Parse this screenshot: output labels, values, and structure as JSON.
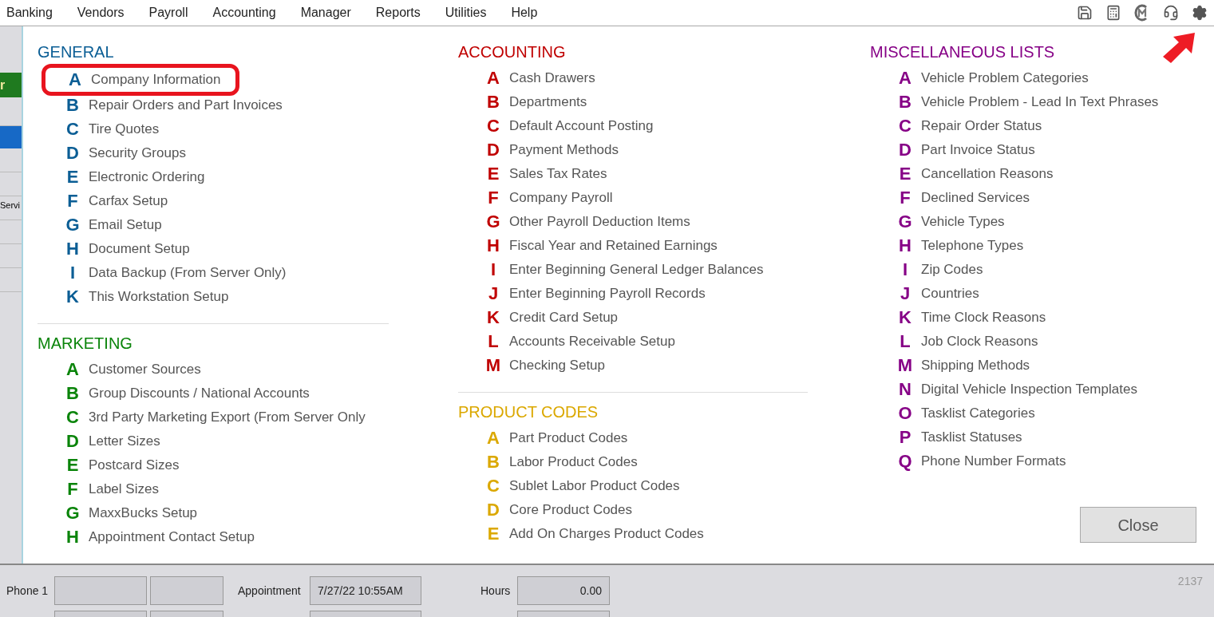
{
  "menu": [
    "Banking",
    "Vendors",
    "Payroll",
    "Accounting",
    "Manager",
    "Reports",
    "Utilities",
    "Help"
  ],
  "left_strip": {
    "button": "r",
    "text": "Servi"
  },
  "columns": [
    [
      {
        "title": "GENERAL",
        "color": "#0b5e95",
        "items": [
          {
            "letter": "A",
            "label": "Company Information",
            "circled": true
          },
          {
            "letter": "B",
            "label": "Repair Orders and Part Invoices",
            "circled": false
          },
          {
            "letter": "C",
            "label": "Tire Quotes",
            "circled": false
          },
          {
            "letter": "D",
            "label": "Security Groups",
            "circled": false
          },
          {
            "letter": "E",
            "label": "Electronic Ordering",
            "circled": false
          },
          {
            "letter": "F",
            "label": "Carfax Setup",
            "circled": false
          },
          {
            "letter": "G",
            "label": "Email Setup",
            "circled": false
          },
          {
            "letter": "H",
            "label": "Document Setup",
            "circled": false
          },
          {
            "letter": "I",
            "label": "Data Backup (From Server Only)",
            "circled": false
          },
          {
            "letter": "K",
            "label": "This Workstation Setup",
            "circled": false
          }
        ]
      },
      {
        "title": "MARKETING",
        "color": "#0a840a",
        "items": [
          {
            "letter": "A",
            "label": "Customer Sources",
            "circled": false
          },
          {
            "letter": "B",
            "label": "Group Discounts / National Accounts",
            "circled": false
          },
          {
            "letter": "C",
            "label": "3rd Party Marketing Export (From Server Only",
            "circled": false
          },
          {
            "letter": "D",
            "label": "Letter Sizes",
            "circled": false
          },
          {
            "letter": "E",
            "label": "Postcard Sizes",
            "circled": false
          },
          {
            "letter": "F",
            "label": "Label Sizes",
            "circled": false
          },
          {
            "letter": "G",
            "label": "MaxxBucks Setup",
            "circled": false
          },
          {
            "letter": "H",
            "label": "Appointment Contact Setup",
            "circled": false
          }
        ]
      }
    ],
    [
      {
        "title": "ACCOUNTING",
        "color": "#c00000",
        "items": [
          {
            "letter": "A",
            "label": "Cash Drawers",
            "circled": false
          },
          {
            "letter": "B",
            "label": "Departments",
            "circled": false
          },
          {
            "letter": "C",
            "label": "Default Account Posting",
            "circled": false
          },
          {
            "letter": "D",
            "label": "Payment Methods",
            "circled": false
          },
          {
            "letter": "E",
            "label": "Sales Tax Rates",
            "circled": false
          },
          {
            "letter": "F",
            "label": "Company Payroll",
            "circled": false
          },
          {
            "letter": "G",
            "label": "Other Payroll Deduction Items",
            "circled": false
          },
          {
            "letter": "H",
            "label": "Fiscal Year and Retained Earnings",
            "circled": false
          },
          {
            "letter": "I",
            "label": "Enter Beginning General Ledger Balances",
            "circled": false
          },
          {
            "letter": "J",
            "label": "Enter Beginning Payroll Records",
            "circled": false
          },
          {
            "letter": "K",
            "label": "Credit Card Setup",
            "circled": false
          },
          {
            "letter": "L",
            "label": "Accounts Receivable Setup",
            "circled": false
          },
          {
            "letter": "M",
            "label": "Checking Setup",
            "circled": false
          }
        ]
      },
      {
        "title": "PRODUCT CODES",
        "color": "#dba800",
        "items": [
          {
            "letter": "A",
            "label": "Part Product Codes",
            "circled": false
          },
          {
            "letter": "B",
            "label": "Labor Product Codes",
            "circled": false
          },
          {
            "letter": "C",
            "label": "Sublet Labor Product Codes",
            "circled": false
          },
          {
            "letter": "D",
            "label": "Core Product Codes",
            "circled": false
          },
          {
            "letter": "E",
            "label": "Add On Charges Product Codes",
            "circled": false
          }
        ]
      }
    ],
    [
      {
        "title": "MISCELLANEOUS LISTS",
        "color": "#860086",
        "items": [
          {
            "letter": "A",
            "label": "Vehicle Problem Categories",
            "circled": false
          },
          {
            "letter": "B",
            "label": "Vehicle Problem - Lead In Text Phrases",
            "circled": false
          },
          {
            "letter": "C",
            "label": "Repair Order Status",
            "circled": false
          },
          {
            "letter": "D",
            "label": "Part Invoice Status",
            "circled": false
          },
          {
            "letter": "E",
            "label": "Cancellation Reasons",
            "circled": false
          },
          {
            "letter": "F",
            "label": "Declined Services",
            "circled": false
          },
          {
            "letter": "G",
            "label": "Vehicle Types",
            "circled": false
          },
          {
            "letter": "H",
            "label": "Telephone Types",
            "circled": false
          },
          {
            "letter": "I",
            "label": "Zip Codes",
            "circled": false
          },
          {
            "letter": "J",
            "label": "Countries",
            "circled": false
          },
          {
            "letter": "K",
            "label": "Time Clock Reasons",
            "circled": false
          },
          {
            "letter": "L",
            "label": "Job Clock Reasons",
            "circled": false
          },
          {
            "letter": "M",
            "label": "Shipping Methods",
            "circled": false
          },
          {
            "letter": "N",
            "label": "Digital Vehicle Inspection Templates",
            "circled": false
          },
          {
            "letter": "O",
            "label": "Tasklist Categories",
            "circled": false
          },
          {
            "letter": "P",
            "label": "Tasklist Statuses",
            "circled": false
          },
          {
            "letter": "Q",
            "label": "Phone Number Formats",
            "circled": false
          }
        ]
      }
    ]
  ],
  "close_button": "Close",
  "bottom": {
    "phone_label": "Phone 1",
    "appointment_label": "Appointment",
    "appointment_value": "7/27/22 10:55AM",
    "hours_label": "Hours",
    "hours_value": "0.00",
    "record_number": "2137"
  }
}
